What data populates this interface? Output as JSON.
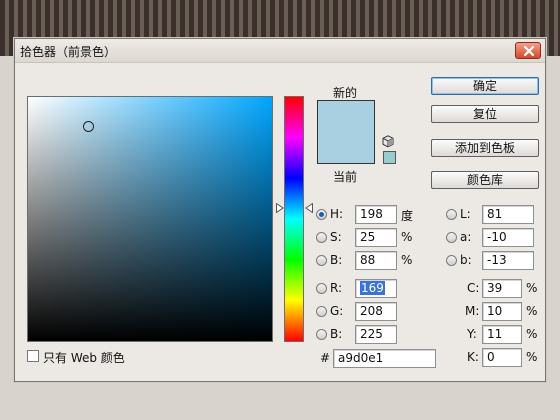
{
  "window": {
    "title": "拾色器（前景色）"
  },
  "swatches": {
    "new_label": "新的",
    "current_label": "当前",
    "new_color": "#a9d0e1",
    "current_color": "#a9d0e1",
    "web_safe_color": "#99cccc"
  },
  "field": {
    "hue_color": "#00a6ff"
  },
  "buttons": {
    "ok": "确定",
    "reset": "复位",
    "add_to_swatches": "添加到色板",
    "color_libraries": "颜色库"
  },
  "hsb": {
    "h": {
      "label": "H:",
      "value": "198",
      "unit": "度",
      "selected": true
    },
    "s": {
      "label": "S:",
      "value": "25",
      "unit": "%"
    },
    "b": {
      "label": "B:",
      "value": "88",
      "unit": "%"
    }
  },
  "rgb": {
    "r": {
      "label": "R:",
      "value": "169"
    },
    "g": {
      "label": "G:",
      "value": "208"
    },
    "b": {
      "label": "B:",
      "value": "225"
    }
  },
  "lab": {
    "l": {
      "label": "L:",
      "value": "81"
    },
    "a": {
      "label": "a:",
      "value": "-10"
    },
    "b": {
      "label": "b:",
      "value": "-13"
    }
  },
  "cmyk": {
    "c": {
      "label": "C:",
      "value": "39",
      "unit": "%"
    },
    "m": {
      "label": "M:",
      "value": "10",
      "unit": "%"
    },
    "y": {
      "label": "Y:",
      "value": "11",
      "unit": "%"
    },
    "k": {
      "label": "K:",
      "value": "0",
      "unit": "%"
    }
  },
  "hex": {
    "label": "#",
    "value": "a9d0e1"
  },
  "web_colors": {
    "label": "只有 Web 颜色",
    "checked": false
  }
}
